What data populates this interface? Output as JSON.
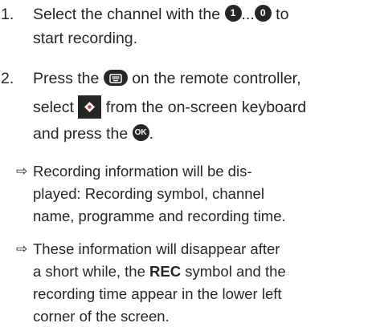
{
  "step1": {
    "number": "1.",
    "line1_before": "Select the channel with the ",
    "icon_first": "1",
    "ellipsis": "...",
    "icon_last": "0",
    "line1_after": " to",
    "line2": "start recording."
  },
  "step2": {
    "number": "2.",
    "line1_before": "Press the ",
    "keyboard_icon": "keyboard-icon",
    "line1_after": " on the remote controller,",
    "line2_before": "select ",
    "record_icon": "record-diamond-icon",
    "line2_after": " from the on-screen keyboard",
    "line3_before": "and press the ",
    "ok_icon": "OK",
    "line3_after": "."
  },
  "result1": {
    "arrow": "⇨",
    "lines": [
      "Recording information will be dis-",
      "played: Recording symbol, channel",
      "name, programme and recording time."
    ]
  },
  "result2": {
    "arrow": "⇨",
    "line1": "These information will disappear after",
    "line2_before": "a short while, the ",
    "line2_bold": "REC",
    "line2_after": " symbol and the",
    "line3": "recording time appear in the lower left",
    "line4": "corner of the screen."
  }
}
